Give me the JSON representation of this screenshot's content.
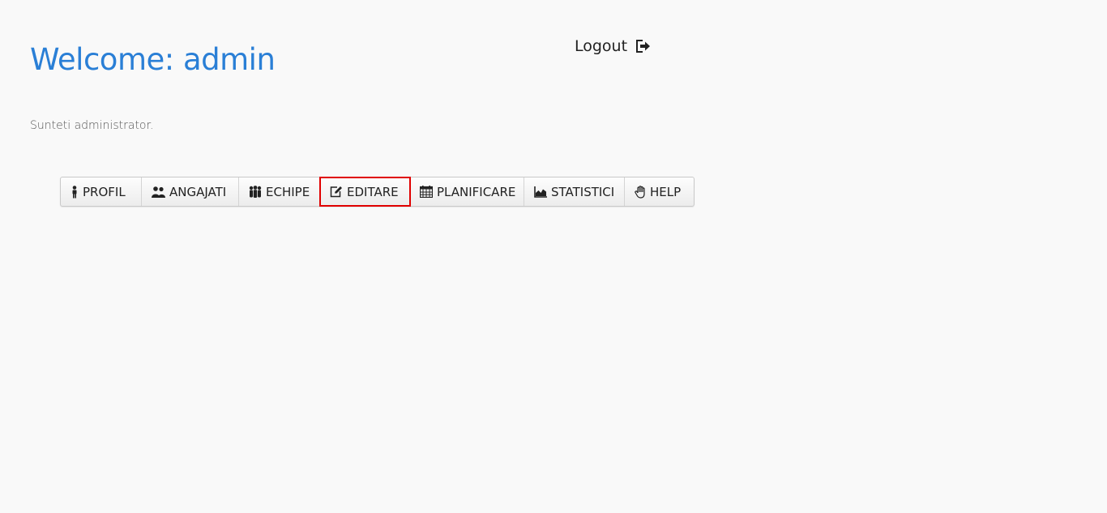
{
  "header": {
    "welcome_title": "Welcome: admin",
    "logout_label": "Logout",
    "role_text": "Sunteti administrator."
  },
  "menu": {
    "items": [
      {
        "label": "PROFIL",
        "icon": "person-icon"
      },
      {
        "label": "ANGAJATI",
        "icon": "users-icon"
      },
      {
        "label": "ECHIPE",
        "icon": "group-icon"
      },
      {
        "label": "EDITARE",
        "icon": "edit-icon",
        "highlighted": true
      },
      {
        "label": "PLANIFICARE",
        "icon": "calendar-icon"
      },
      {
        "label": "STATISTICI",
        "icon": "area-chart-icon"
      },
      {
        "label": "HELP",
        "icon": "hand-icon"
      }
    ]
  },
  "colors": {
    "accent": "#2a7fd6",
    "highlight": "#e00000",
    "background": "#f9f9f9"
  }
}
